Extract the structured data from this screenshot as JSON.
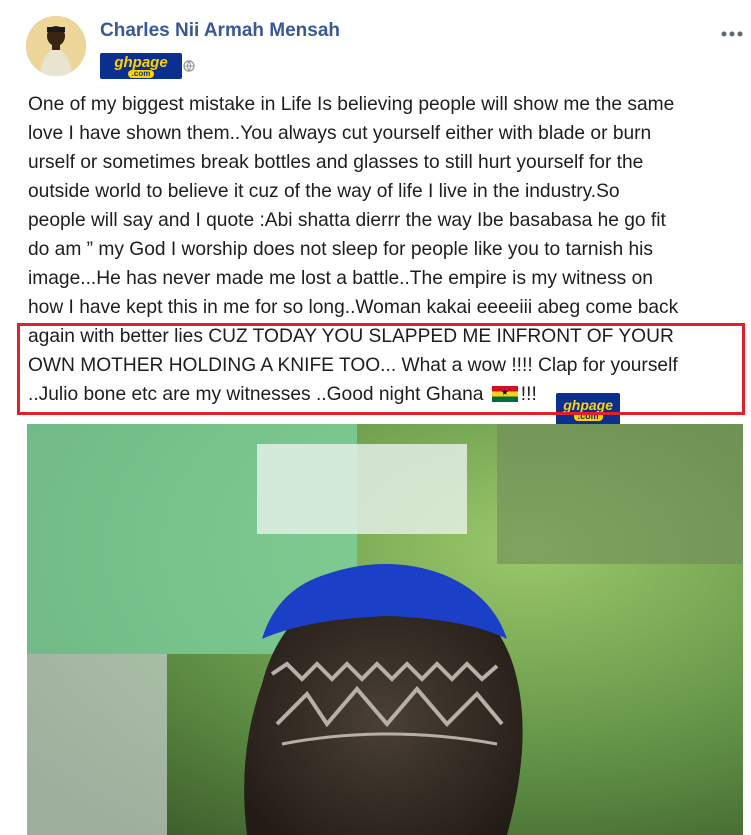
{
  "post": {
    "author": "Charles Nii Armah Mensah",
    "badge_logo": {
      "main": "ghpage",
      "sub": ".com"
    },
    "menu_icon": "more-horizontal-icon",
    "lines": [
      "One of my biggest mistake in Life Is believing people will show me the same",
      "love I have shown them..You always cut yourself either with blade or burn",
      "urself or sometimes break bottles and glasses to still hurt yourself for the",
      "outside world to believe it cuz of the way of life I live in the industry.So",
      "people will say and I quote :Abi shatta dierrr the way Ibe basabasa he go fit",
      "do am ” my God I worship does not sleep for people like you to tarnish his",
      "image...He has never made me lost a battle..The empire is my witness on",
      "how I have kept this in me for so long..Woman kakai eeeeiii abeg come back"
    ],
    "highlighted_lines": [
      "again with better lies CUZ TODAY YOU SLAPPED ME INFRONT OF YOUR",
      "OWN MOTHER HOLDING A KNIFE TOO... What a wow !!!! Clap for yourself"
    ],
    "last_line_text": "..Julio bone etc are my witnesses ..Good night Ghana",
    "last_line_suffix": "!!!",
    "flag_icon": "ghana-flag-icon",
    "highlight_color": "#e0202a",
    "name_color": "#385898"
  }
}
